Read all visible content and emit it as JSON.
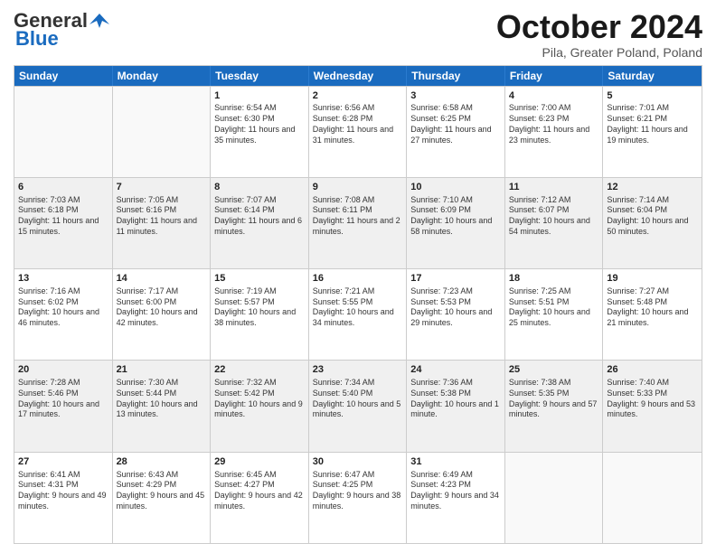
{
  "header": {
    "logo_general": "General",
    "logo_blue": "Blue",
    "month_title": "October 2024",
    "location": "Pila, Greater Poland, Poland"
  },
  "days_of_week": [
    "Sunday",
    "Monday",
    "Tuesday",
    "Wednesday",
    "Thursday",
    "Friday",
    "Saturday"
  ],
  "weeks": [
    [
      {
        "day": "",
        "info": ""
      },
      {
        "day": "",
        "info": ""
      },
      {
        "day": "1",
        "info": "Sunrise: 6:54 AM\nSunset: 6:30 PM\nDaylight: 11 hours and 35 minutes."
      },
      {
        "day": "2",
        "info": "Sunrise: 6:56 AM\nSunset: 6:28 PM\nDaylight: 11 hours and 31 minutes."
      },
      {
        "day": "3",
        "info": "Sunrise: 6:58 AM\nSunset: 6:25 PM\nDaylight: 11 hours and 27 minutes."
      },
      {
        "day": "4",
        "info": "Sunrise: 7:00 AM\nSunset: 6:23 PM\nDaylight: 11 hours and 23 minutes."
      },
      {
        "day": "5",
        "info": "Sunrise: 7:01 AM\nSunset: 6:21 PM\nDaylight: 11 hours and 19 minutes."
      }
    ],
    [
      {
        "day": "6",
        "info": "Sunrise: 7:03 AM\nSunset: 6:18 PM\nDaylight: 11 hours and 15 minutes."
      },
      {
        "day": "7",
        "info": "Sunrise: 7:05 AM\nSunset: 6:16 PM\nDaylight: 11 hours and 11 minutes."
      },
      {
        "day": "8",
        "info": "Sunrise: 7:07 AM\nSunset: 6:14 PM\nDaylight: 11 hours and 6 minutes."
      },
      {
        "day": "9",
        "info": "Sunrise: 7:08 AM\nSunset: 6:11 PM\nDaylight: 11 hours and 2 minutes."
      },
      {
        "day": "10",
        "info": "Sunrise: 7:10 AM\nSunset: 6:09 PM\nDaylight: 10 hours and 58 minutes."
      },
      {
        "day": "11",
        "info": "Sunrise: 7:12 AM\nSunset: 6:07 PM\nDaylight: 10 hours and 54 minutes."
      },
      {
        "day": "12",
        "info": "Sunrise: 7:14 AM\nSunset: 6:04 PM\nDaylight: 10 hours and 50 minutes."
      }
    ],
    [
      {
        "day": "13",
        "info": "Sunrise: 7:16 AM\nSunset: 6:02 PM\nDaylight: 10 hours and 46 minutes."
      },
      {
        "day": "14",
        "info": "Sunrise: 7:17 AM\nSunset: 6:00 PM\nDaylight: 10 hours and 42 minutes."
      },
      {
        "day": "15",
        "info": "Sunrise: 7:19 AM\nSunset: 5:57 PM\nDaylight: 10 hours and 38 minutes."
      },
      {
        "day": "16",
        "info": "Sunrise: 7:21 AM\nSunset: 5:55 PM\nDaylight: 10 hours and 34 minutes."
      },
      {
        "day": "17",
        "info": "Sunrise: 7:23 AM\nSunset: 5:53 PM\nDaylight: 10 hours and 29 minutes."
      },
      {
        "day": "18",
        "info": "Sunrise: 7:25 AM\nSunset: 5:51 PM\nDaylight: 10 hours and 25 minutes."
      },
      {
        "day": "19",
        "info": "Sunrise: 7:27 AM\nSunset: 5:48 PM\nDaylight: 10 hours and 21 minutes."
      }
    ],
    [
      {
        "day": "20",
        "info": "Sunrise: 7:28 AM\nSunset: 5:46 PM\nDaylight: 10 hours and 17 minutes."
      },
      {
        "day": "21",
        "info": "Sunrise: 7:30 AM\nSunset: 5:44 PM\nDaylight: 10 hours and 13 minutes."
      },
      {
        "day": "22",
        "info": "Sunrise: 7:32 AM\nSunset: 5:42 PM\nDaylight: 10 hours and 9 minutes."
      },
      {
        "day": "23",
        "info": "Sunrise: 7:34 AM\nSunset: 5:40 PM\nDaylight: 10 hours and 5 minutes."
      },
      {
        "day": "24",
        "info": "Sunrise: 7:36 AM\nSunset: 5:38 PM\nDaylight: 10 hours and 1 minute."
      },
      {
        "day": "25",
        "info": "Sunrise: 7:38 AM\nSunset: 5:35 PM\nDaylight: 9 hours and 57 minutes."
      },
      {
        "day": "26",
        "info": "Sunrise: 7:40 AM\nSunset: 5:33 PM\nDaylight: 9 hours and 53 minutes."
      }
    ],
    [
      {
        "day": "27",
        "info": "Sunrise: 6:41 AM\nSunset: 4:31 PM\nDaylight: 9 hours and 49 minutes."
      },
      {
        "day": "28",
        "info": "Sunrise: 6:43 AM\nSunset: 4:29 PM\nDaylight: 9 hours and 45 minutes."
      },
      {
        "day": "29",
        "info": "Sunrise: 6:45 AM\nSunset: 4:27 PM\nDaylight: 9 hours and 42 minutes."
      },
      {
        "day": "30",
        "info": "Sunrise: 6:47 AM\nSunset: 4:25 PM\nDaylight: 9 hours and 38 minutes."
      },
      {
        "day": "31",
        "info": "Sunrise: 6:49 AM\nSunset: 4:23 PM\nDaylight: 9 hours and 34 minutes."
      },
      {
        "day": "",
        "info": ""
      },
      {
        "day": "",
        "info": ""
      }
    ]
  ]
}
